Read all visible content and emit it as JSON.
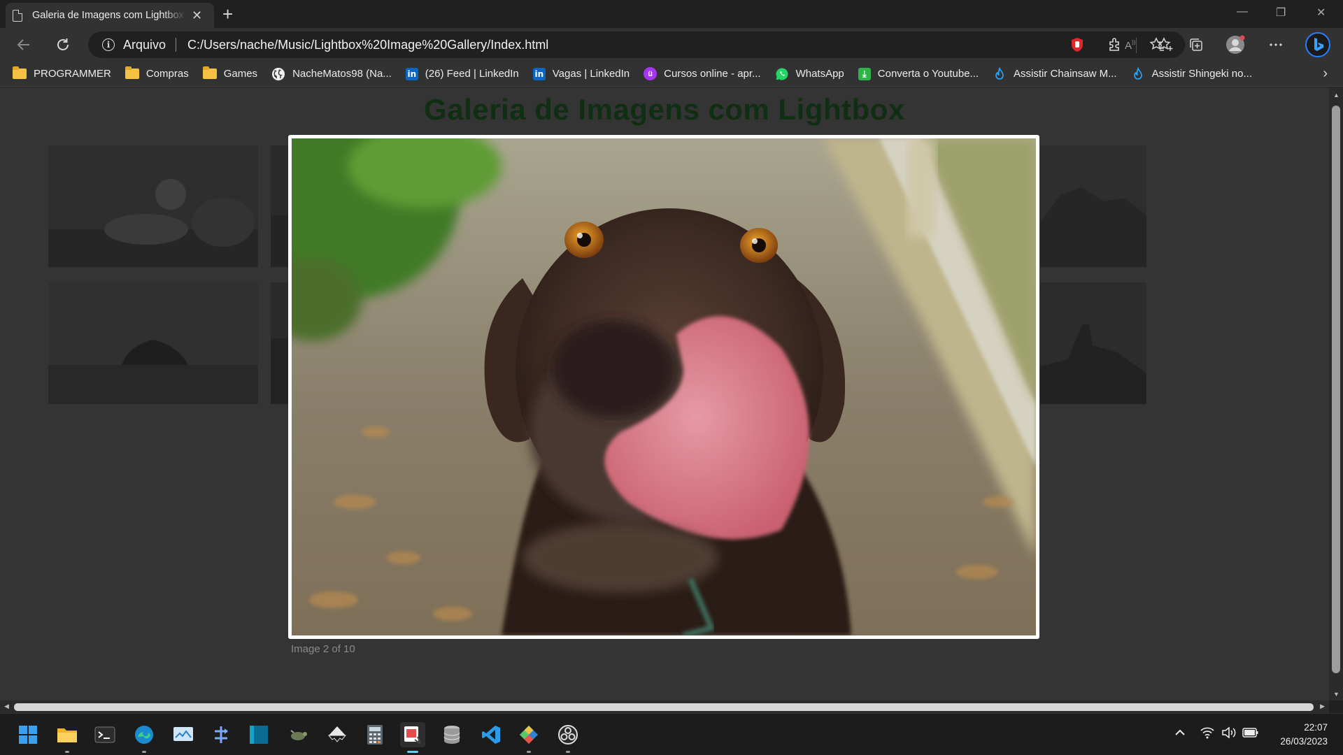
{
  "tab": {
    "title": "Galeria de Imagens com Lightbox",
    "close_glyph": "✕"
  },
  "new_tab_glyph": "+",
  "window_controls": {
    "minimize": "—",
    "restore": "❐",
    "close": "✕"
  },
  "address": {
    "scheme_label": "Arquivo",
    "url": "C:/Users/nache/Music/Lightbox%20Image%20Gallery/Index.html"
  },
  "bookmarks": [
    {
      "label": "PROGRAMMER",
      "icon": "folder-icon"
    },
    {
      "label": "Compras",
      "icon": "folder-icon"
    },
    {
      "label": "Games",
      "icon": "folder-icon"
    },
    {
      "label": "NacheMatos98 (Na...",
      "icon": "github-icon"
    },
    {
      "label": "(26) Feed | LinkedIn",
      "icon": "linkedin-icon"
    },
    {
      "label": "Vagas | LinkedIn",
      "icon": "linkedin-icon"
    },
    {
      "label": "Cursos online - apr...",
      "icon": "udemy-icon"
    },
    {
      "label": "WhatsApp",
      "icon": "whatsapp-icon"
    },
    {
      "label": "Converta o Youtube...",
      "icon": "download-icon"
    },
    {
      "label": "Assistir Chainsaw M...",
      "icon": "fire-icon"
    },
    {
      "label": "Assistir Shingeki no...",
      "icon": "fire-icon"
    }
  ],
  "page": {
    "title": "Galeria de Imagens com Lightbox",
    "caption": "Image 2 of 10"
  },
  "taskbar": {
    "time": "22:07",
    "date": "26/03/2023"
  },
  "colors": {
    "page_title": "#0f2e12",
    "lightbox_border": "#ffffff",
    "taskbar_active": "#5fd0f0"
  }
}
